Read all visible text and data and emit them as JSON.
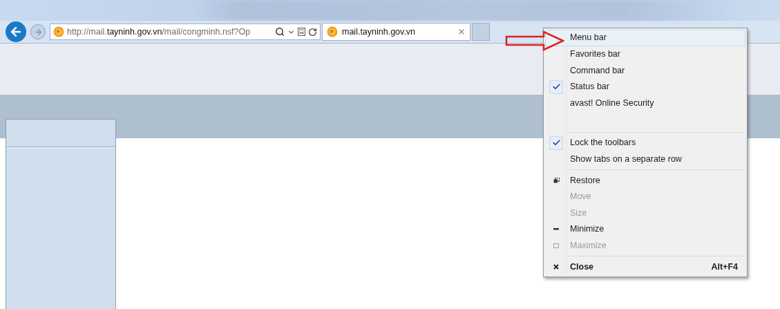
{
  "address_bar": {
    "url": "http://mail.**tayninh.gov.vn**/mail/congminh.nsf?Op"
  },
  "tab": {
    "title": "mail.tayninh.gov.vn",
    "selected": true
  },
  "context_menu": {
    "items": [
      {
        "kind": "toggle",
        "label": "Menu bar",
        "checked": false,
        "selected": true
      },
      {
        "kind": "toggle",
        "label": "Favorites bar",
        "checked": false,
        "selected": false
      },
      {
        "kind": "toggle",
        "label": "Command bar",
        "checked": false,
        "selected": false
      },
      {
        "kind": "toggle",
        "label": "Status bar",
        "checked": true,
        "selected": false
      },
      {
        "kind": "toggle",
        "label": "avast! Online Security",
        "checked": false,
        "selected": false
      },
      {
        "kind": "gap"
      },
      {
        "kind": "separator"
      },
      {
        "kind": "toggle",
        "label": "Lock the toolbars",
        "checked": true,
        "selected": false
      },
      {
        "kind": "toggle",
        "label": "Show tabs on a separate row",
        "checked": false,
        "selected": false
      },
      {
        "kind": "separator"
      },
      {
        "kind": "restore",
        "label": "Restore",
        "disabled": false,
        "selected": false
      },
      {
        "kind": "plain",
        "label": "Move",
        "disabled": true,
        "selected": false
      },
      {
        "kind": "plain",
        "label": "Size",
        "disabled": true,
        "selected": false
      },
      {
        "kind": "minimize",
        "label": "Minimize",
        "disabled": false,
        "selected": false
      },
      {
        "kind": "maximize",
        "label": "Maximize",
        "disabled": true,
        "selected": false
      },
      {
        "kind": "separator"
      },
      {
        "kind": "close",
        "label": "Close",
        "shortcut": "Alt+F4",
        "disabled": false,
        "selected": false
      }
    ]
  }
}
